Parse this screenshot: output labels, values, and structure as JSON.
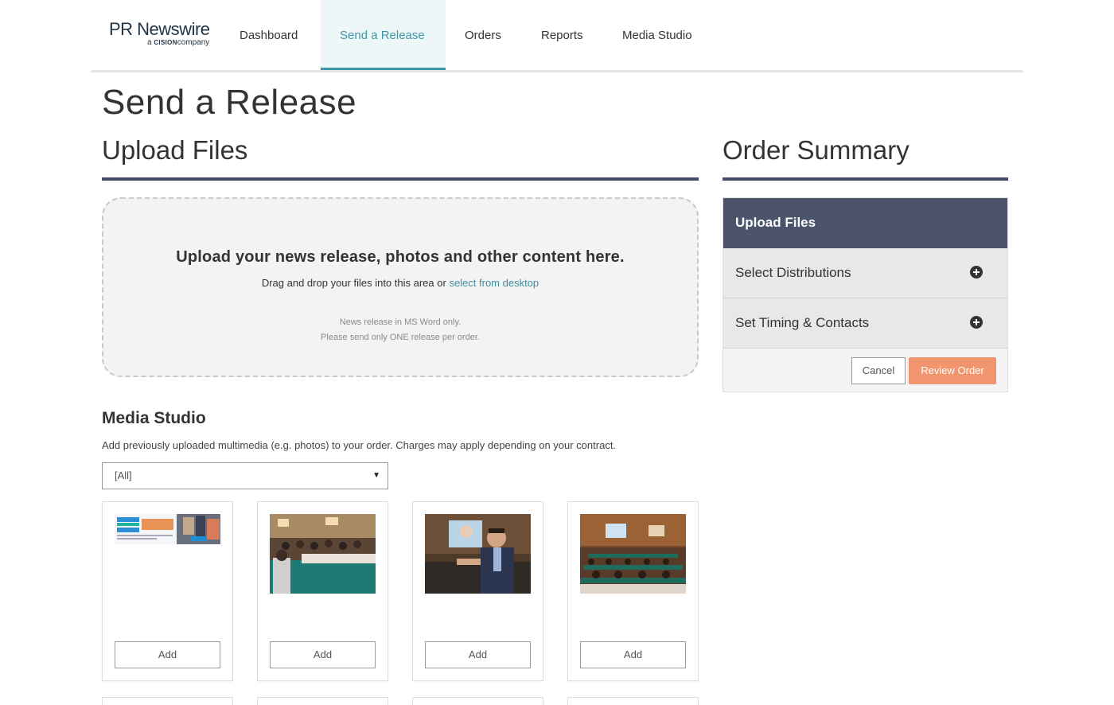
{
  "brand": {
    "name": "PR Newswire",
    "tagline_prefix": "a",
    "tagline_brand": "CISION",
    "tagline_suffix": "company"
  },
  "nav": {
    "items": [
      {
        "label": "Dashboard"
      },
      {
        "label": "Send a Release",
        "active": true
      },
      {
        "label": "Orders"
      },
      {
        "label": "Reports"
      },
      {
        "label": "Media Studio"
      }
    ]
  },
  "page": {
    "title": "Send a Release"
  },
  "upload": {
    "section_title": "Upload Files",
    "heading": "Upload your news release, photos and other content here.",
    "instruction": "Drag and drop your files into this area or",
    "link": "select from desktop",
    "note1": "News release in MS Word only.",
    "note2": "Please send only ONE release per order."
  },
  "media_studio": {
    "title": "Media Studio",
    "description": "Add previously uploaded multimedia (e.g. photos) to your order. Charges may apply depending on your contract.",
    "filter_value": "[All]",
    "items": [
      {
        "thumb": "retail-conference-banner",
        "add_label": "Add"
      },
      {
        "thumb": "seminar-audience-photo",
        "add_label": "Add"
      },
      {
        "thumb": "speaker-presenting-photo",
        "add_label": "Add"
      },
      {
        "thumb": "conference-hall-photo",
        "add_label": "Add"
      }
    ]
  },
  "order_summary": {
    "title": "Order Summary",
    "steps": [
      {
        "label": "Upload Files",
        "active": true
      },
      {
        "label": "Select Distributions",
        "icon": "plus-circle-icon"
      },
      {
        "label": "Set Timing & Contacts",
        "icon": "plus-circle-icon"
      }
    ],
    "cancel_label": "Cancel",
    "review_label": "Review Order"
  },
  "colors": {
    "accent": "#3d96a8",
    "nav_active_bg": "#eef7f8",
    "panel_dark": "#4b546b",
    "rule": "#444e66",
    "review_button": "#f0956d"
  }
}
